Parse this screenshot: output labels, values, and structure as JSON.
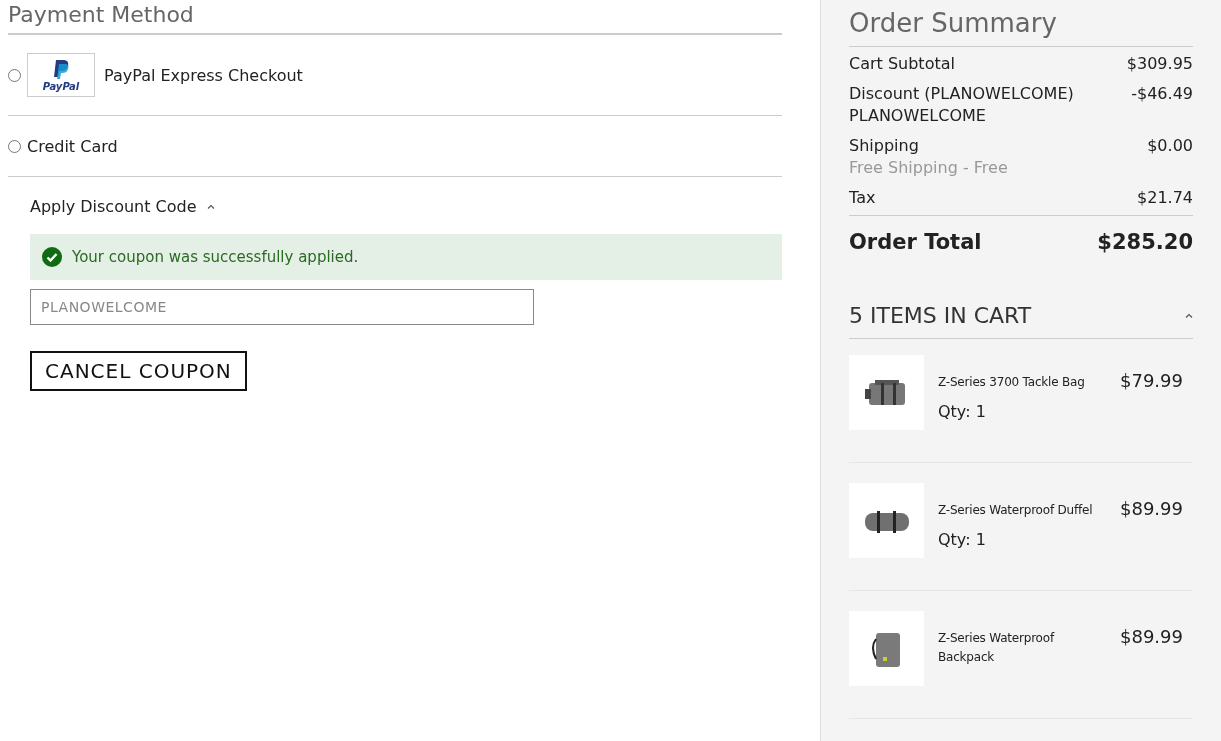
{
  "payment": {
    "title": "Payment Method",
    "methods": [
      {
        "kind": "paypal",
        "logo_text": "PayPal",
        "label": "PayPal Express Checkout",
        "selected": false
      },
      {
        "kind": "plain",
        "label": "Credit Card",
        "selected": false
      }
    ]
  },
  "discount": {
    "title": "Apply Discount Code",
    "expanded": true,
    "message": "Your coupon was successfully applied.",
    "code": "PLANOWELCOME",
    "disabled": true,
    "button": "CANCEL COUPON"
  },
  "summary": {
    "title": "Order Summary",
    "rows": [
      {
        "label": "Cart Subtotal",
        "amount": "$309.95"
      },
      {
        "label": "Discount (PLANOWELCOME)",
        "note": "PLANOWELCOME",
        "note_muted": false,
        "amount": "-$46.49"
      },
      {
        "label": "Shipping",
        "note": "Free Shipping - Free",
        "note_muted": true,
        "amount": "$0.00"
      },
      {
        "label": "Tax",
        "amount": "$21.74"
      }
    ],
    "total_label": "Order Total",
    "total": "$285.20",
    "cart": {
      "title": "5 ITEMS IN CART",
      "expanded": true,
      "items": [
        {
          "kind": "case",
          "name": "Z-Series 3700 Tackle Bag",
          "price": "$79.99",
          "qty": "Qty: 1"
        },
        {
          "kind": "duffel",
          "name": "Z-Series Waterproof Duffel",
          "price": "$89.99",
          "qty": "Qty: 1"
        },
        {
          "kind": "backpack",
          "name": "Z-Series Waterproof Backpack",
          "price": "$89.99"
        }
      ]
    }
  }
}
